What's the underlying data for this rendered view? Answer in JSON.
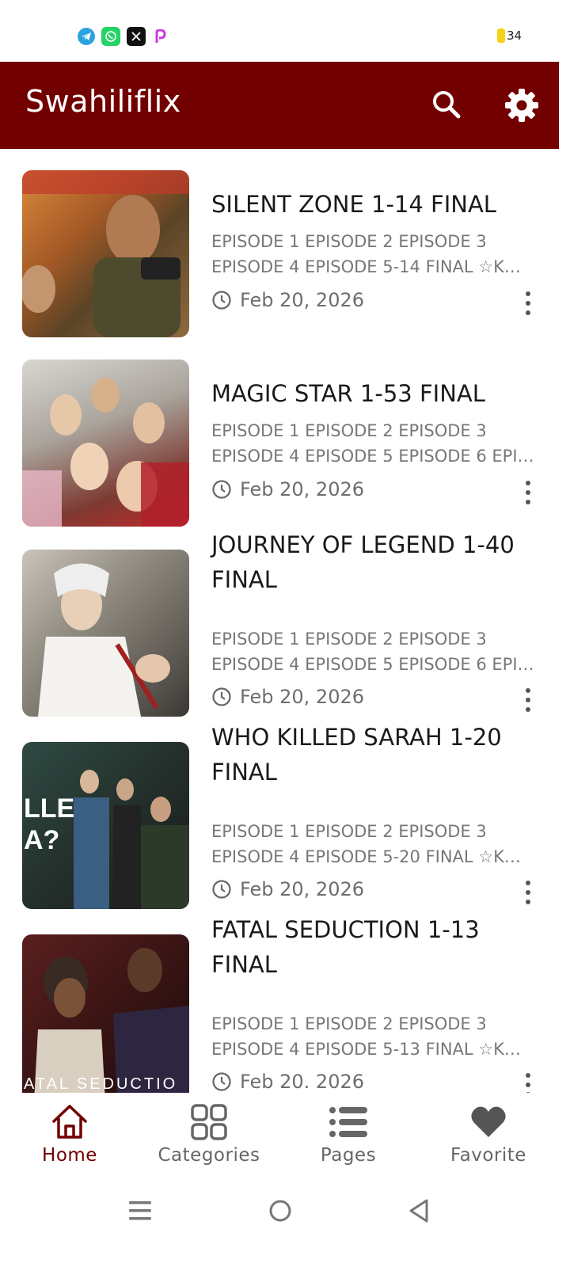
{
  "status_bar": {
    "battery_level": "34",
    "app_icons": [
      "telegram-icon",
      "whatsapp-icon",
      "x-icon",
      "picsart-icon"
    ]
  },
  "app_bar": {
    "title": "Swahiliflix",
    "background": "#720000"
  },
  "posts": [
    {
      "title": "SILENT ZONE 1-14 FINAL",
      "excerpt": "EPISODE 1 EPISODE 2 EPISODE 3 EPISODE 4 EPISODE 5-14 FINAL ☆K…",
      "date": "Feb 20, 2026"
    },
    {
      "title": "MAGIC STAR 1-53 FINAL",
      "excerpt": "EPISODE 1 EPISODE 2 EPISODE 3 EPISODE 4 EPISODE 5 EPISODE 6 EPI…",
      "date": "Feb 20, 2026"
    },
    {
      "title": "JOURNEY OF LEGEND 1-40 FINAL",
      "excerpt": "EPISODE 1 EPISODE 2 EPISODE 3 EPISODE 4 EPISODE 5 EPISODE 6 EPI…",
      "date": "Feb 20, 2026"
    },
    {
      "title": "WHO KILLED SARAH 1-20 FINAL",
      "excerpt": "EPISODE 1 EPISODE 2 EPISODE 3 EPISODE 4 EPISODE 5-20 FINAL ☆K…",
      "date": "Feb 20, 2026"
    },
    {
      "title": "FATAL SEDUCTION 1-13 FINAL",
      "excerpt": "EPISODE 1 EPISODE 2 EPISODE 3 EPISODE 4 EPISODE 5-13 FINAL ☆K…",
      "date": "Feb 20. 2026",
      "thumb_caption": "ATAL SEDUCTIO"
    }
  ],
  "bottom_nav": {
    "items": [
      {
        "label": "Home",
        "icon": "home-icon",
        "active": true
      },
      {
        "label": "Categories",
        "icon": "categories-icon",
        "active": false
      },
      {
        "label": "Pages",
        "icon": "list-icon",
        "active": false
      },
      {
        "label": "Favorite",
        "icon": "heart-icon",
        "active": false
      }
    ]
  },
  "colors": {
    "accent": "#720000",
    "text_secondary": "#777777"
  }
}
